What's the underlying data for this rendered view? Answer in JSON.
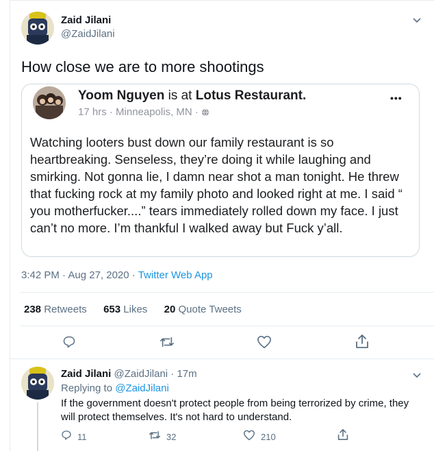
{
  "main_tweet": {
    "author_name": "Zaid Jilani",
    "author_handle": "@ZaidJilani",
    "text": "How close we are to more shootings",
    "timestamp": "3:42 PM · Aug 27, 2020 ·",
    "source": "Twitter Web App",
    "stats": {
      "retweets_count": "238",
      "retweets_label": "Retweets",
      "likes_count": "653",
      "likes_label": "Likes",
      "quotes_count": "20",
      "quotes_label": "Quote Tweets"
    }
  },
  "embedded_post": {
    "author": "Yoom Nguyen",
    "is_at": "is at",
    "place": "Lotus Restaurant.",
    "meta": "17 hrs · Minneapolis, MN ·",
    "more": "•••",
    "body": "Watching looters bust down our family restaurant is so heartbreaking. Senseless, they’re doing it while laughing and smirking. Not gonna lie, I damn near shot a man tonight. He threw that fucking rock at my family photo and looked right at me. I said “ you motherfucker....” tears immediately rolled down my face. I just can’t no more. I’m thankful I walked away but Fuck y’all."
  },
  "reply": {
    "author_name": "Zaid Jilani",
    "author_handle": "@ZaidJilani · 17m",
    "replying_label": "Replying to",
    "replying_handle": "@ZaidJilani",
    "text": "If the government doesn't protect people from being terrorized by crime, they will protect themselves. It's not hard to understand.",
    "reply_count": "11",
    "retweet_count": "32",
    "like_count": "210"
  },
  "icons": [
    "reply-icon",
    "retweet-icon",
    "like-icon",
    "share-icon",
    "chevron-down-icon",
    "globe-icon"
  ],
  "colors": {
    "accent": "#1b95e0",
    "muted": "#5b7083",
    "border": "#e6ecf0"
  }
}
